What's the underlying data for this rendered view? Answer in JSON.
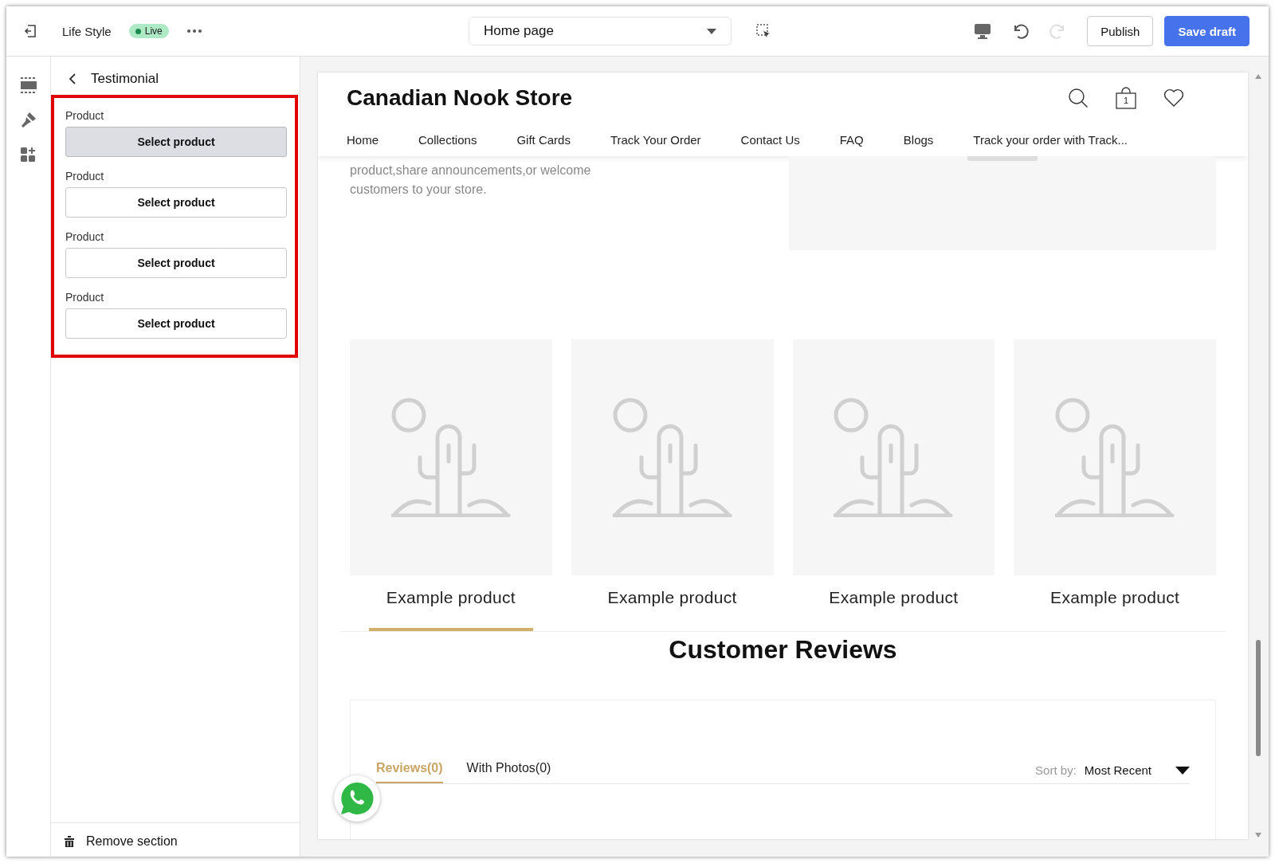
{
  "topbar": {
    "theme_name": "Life Style",
    "status": "Live",
    "page_select": {
      "value": "Home page"
    },
    "buttons": [
      {
        "label": "Publish",
        "kind": "secondary"
      },
      {
        "label": "Save draft",
        "kind": "primary"
      }
    ]
  },
  "panel": {
    "title": "Testimonial",
    "fields": [
      {
        "label": "Product",
        "button": "Select product",
        "selected": true
      },
      {
        "label": "Product",
        "button": "Select product",
        "selected": false
      },
      {
        "label": "Product",
        "button": "Select product",
        "selected": false
      },
      {
        "label": "Product",
        "button": "Select product",
        "selected": false
      }
    ],
    "footer": "Remove section"
  },
  "preview": {
    "store_name": "Canadian Nook Store",
    "cart_count": "1",
    "nav": [
      "Home",
      "Collections",
      "Gift Cards",
      "Track Your Order",
      "Contact Us",
      "FAQ",
      "Blogs",
      "Track your order with Track..."
    ],
    "intro_text": "product,share announcements,or welcome customers to your store.",
    "products": [
      {
        "title": "Example product",
        "selected": true
      },
      {
        "title": "Example product",
        "selected": false
      },
      {
        "title": "Example product",
        "selected": false
      },
      {
        "title": "Example product",
        "selected": false
      }
    ],
    "reviews": {
      "title": "Customer Reviews",
      "tabs": [
        {
          "label": "Reviews(0)",
          "selected": true
        },
        {
          "label": "With Photos(0)",
          "selected": false
        }
      ],
      "sort_label": "Sort by:",
      "sort_value": "Most Recent"
    }
  }
}
